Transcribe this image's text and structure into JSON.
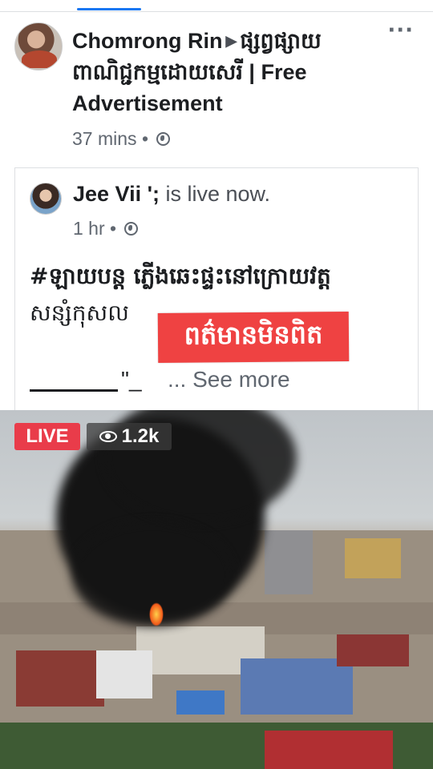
{
  "post": {
    "author": "Chomrong Rin",
    "arrow": "▶",
    "group": "ផ្សព្វផ្សាយពាណិជ្ជកម្មដោយសេរី | Free Advertisement",
    "time": "37 mins",
    "separator": "•",
    "more_icon": "more-options-icon",
    "privacy_icon": "globe-icon"
  },
  "shared": {
    "author": "Jee Vii ';",
    "status": " is live now.",
    "time": "1 hr",
    "separator": "•",
    "text_line1": "#ឡាយបន្ត ភ្លើងឆេះផ្ទះនៅក្រោយវត្ត",
    "text_line2": "សន្សំកុសល",
    "stamp": "ពត៌មានមិនពិត",
    "quote_fragment": "\"_",
    "see_more": "... See more"
  },
  "video": {
    "live_label": "LIVE",
    "viewers": "1.2k",
    "eye_icon": "eye-icon",
    "live_color": "#e93c4a"
  },
  "colors": {
    "accent": "#1877f2",
    "text": "#1c1e21",
    "meta": "#606770",
    "stamp": "#ef4242"
  }
}
